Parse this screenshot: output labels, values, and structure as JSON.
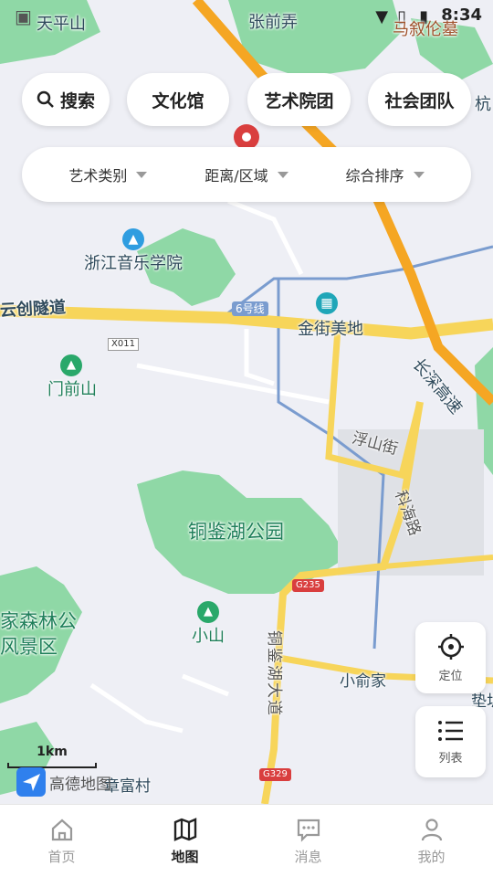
{
  "status_bar": {
    "time": "8:34"
  },
  "top_chips": [
    {
      "label": "搜索",
      "icon": "search-icon"
    },
    {
      "label": "文化馆"
    },
    {
      "label": "艺术院团"
    },
    {
      "label": "社会团队"
    }
  ],
  "filters": [
    {
      "label": "艺术类别"
    },
    {
      "label": "距离/区域"
    },
    {
      "label": "综合排序"
    }
  ],
  "map": {
    "labels": {
      "tianping": "天平山",
      "zhangqian": "张前弄",
      "majiu": "马叙伦墓",
      "hang": "杭",
      "conservatory": "浙江音乐学院",
      "tunnel": "云创隧道",
      "line6": "6号线",
      "jinjie": "金街美地",
      "x011": "X011",
      "menqian": "门前山",
      "changliu": "长深高速",
      "fushan": "浮山街",
      "kehai": "科海路",
      "tongjian_park": "铜鉴湖公园",
      "g235": "G235",
      "forest1": "家森林公",
      "forest2": "风景区",
      "xiaoshan": "小山",
      "tongjian_ave": "铜鉴湖大道",
      "xiaoyu": "小俞家",
      "dian": "垫圳",
      "g329": "G329",
      "zhangfu": "章富村"
    },
    "scale": "1km",
    "logo": "高德地图"
  },
  "fabs": [
    {
      "label": "定位",
      "icon": "locate-icon"
    },
    {
      "label": "列表",
      "icon": "list-icon"
    }
  ],
  "bottom_nav": [
    {
      "label": "首页",
      "icon": "home-icon",
      "active": false
    },
    {
      "label": "地图",
      "icon": "map-icon",
      "active": true
    },
    {
      "label": "消息",
      "icon": "message-icon",
      "active": false
    },
    {
      "label": "我的",
      "icon": "profile-icon",
      "active": false
    }
  ],
  "colors": {
    "highway": "#f5a623",
    "major_road": "#f7d55a",
    "park": "#8fd8a6",
    "metro": "#7a9ccf",
    "accent": "#2f80ed"
  }
}
